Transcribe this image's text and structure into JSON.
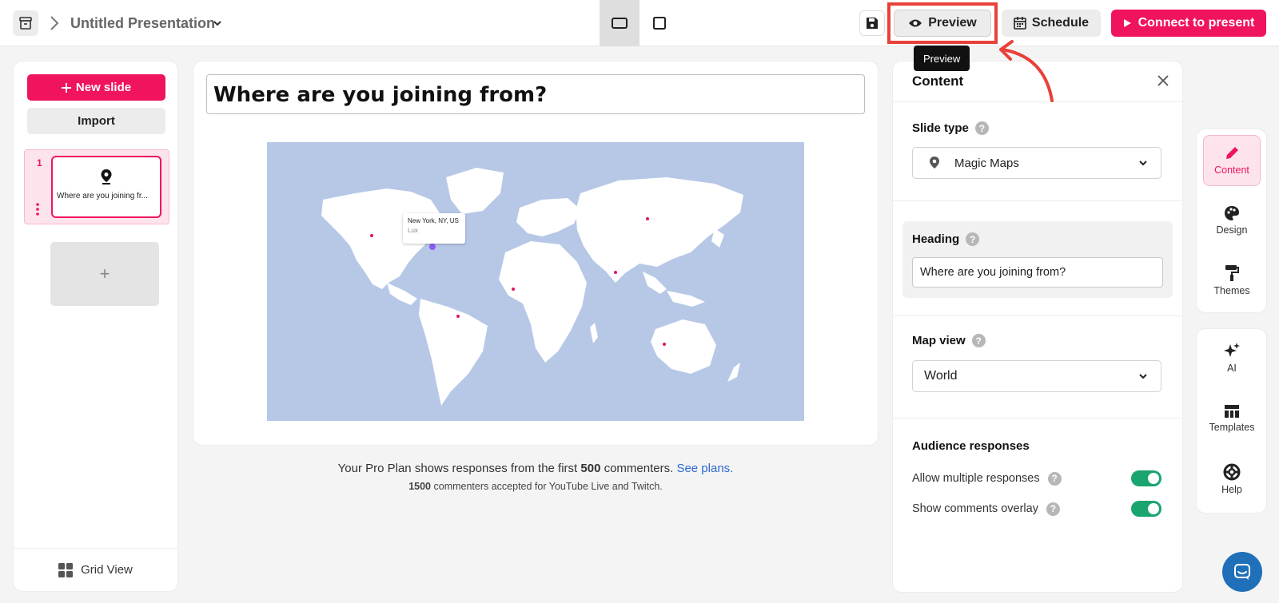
{
  "header": {
    "title": "Untitled Presentation",
    "preview_label": "Preview",
    "preview_tooltip": "Preview",
    "schedule_label": "Schedule",
    "connect_label": "Connect to present"
  },
  "left": {
    "new_slide_label": "New slide",
    "import_label": "Import",
    "slides": [
      {
        "number": "1",
        "title": "Where are you joining fr..."
      }
    ],
    "add_slide_label": "+",
    "grid_view_label": "Grid View"
  },
  "canvas": {
    "heading": "Where are you joining from?",
    "map_tooltip_city": "New York, NY, US",
    "map_tooltip_sub": "Lux"
  },
  "plan_note": {
    "prefix": "Your Pro Plan shows responses from the first ",
    "count": "500",
    "suffix": " commenters. ",
    "link": "See plans.",
    "sub_count": "1500",
    "sub_text": " commenters accepted for YouTube Live and Twitch."
  },
  "content_panel": {
    "title": "Content",
    "slide_type_label": "Slide type",
    "slide_type_value": "Magic Maps",
    "heading_label": "Heading",
    "heading_value": "Where are you joining from?",
    "map_view_label": "Map view",
    "map_view_value": "World",
    "audience_label": "Audience responses",
    "allow_multiple_label": "Allow multiple responses",
    "allow_multiple_on": true,
    "show_overlay_label": "Show comments overlay",
    "show_overlay_on": true,
    "help_glyph": "?"
  },
  "sidebar": {
    "top": [
      {
        "label": "Content",
        "icon": "pencil-icon",
        "active": true
      },
      {
        "label": "Design",
        "icon": "palette-icon",
        "active": false
      },
      {
        "label": "Themes",
        "icon": "paint-roller-icon",
        "active": false
      }
    ],
    "bottom": [
      {
        "label": "AI",
        "icon": "sparkles-icon"
      },
      {
        "label": "Templates",
        "icon": "template-icon"
      },
      {
        "label": "Help",
        "icon": "lifebuoy-icon"
      }
    ]
  },
  "colors": {
    "brand": "#f0135e",
    "toggle_on": "#1aa46f",
    "map_water": "#b6c8e6",
    "highlight": "#e8413a"
  }
}
